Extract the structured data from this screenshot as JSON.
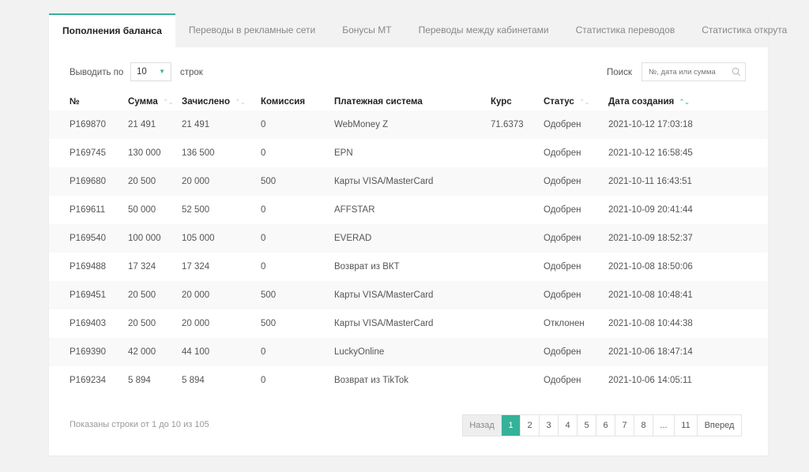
{
  "tabs": [
    {
      "label": "Пополнения баланса",
      "active": true
    },
    {
      "label": "Переводы в рекламные сети"
    },
    {
      "label": "Бонусы МТ"
    },
    {
      "label": "Переводы между кабинетами"
    },
    {
      "label": "Статистика переводов"
    },
    {
      "label": "Статистика открута"
    }
  ],
  "controls": {
    "show_label": "Выводить по",
    "rows_value": "10",
    "rows_suffix": "строк",
    "search_label": "Поиск",
    "search_placeholder": "№, дата или сумма"
  },
  "table": {
    "columns": [
      "№",
      "Сумма",
      "Зачислено",
      "Комиссия",
      "Платежная система",
      "Курс",
      "Статус",
      "Дата создания"
    ],
    "rows": [
      [
        "P169870",
        "21 491",
        "21 491",
        "0",
        "WebMoney Z",
        "71.6373",
        "Одобрен",
        "2021-10-12 17:03:18"
      ],
      [
        "P169745",
        "130 000",
        "136 500",
        "0",
        "EPN",
        "",
        "Одобрен",
        "2021-10-12 16:58:45"
      ],
      [
        "P169680",
        "20 500",
        "20 000",
        "500",
        "Карты VISA/MasterCard",
        "",
        "Одобрен",
        "2021-10-11 16:43:51"
      ],
      [
        "P169611",
        "50 000",
        "52 500",
        "0",
        "AFFSTAR",
        "",
        "Одобрен",
        "2021-10-09 20:41:44"
      ],
      [
        "P169540",
        "100 000",
        "105 000",
        "0",
        "EVERAD",
        "",
        "Одобрен",
        "2021-10-09 18:52:37"
      ],
      [
        "P169488",
        "17 324",
        "17 324",
        "0",
        "Возврат из ВКТ",
        "",
        "Одобрен",
        "2021-10-08 18:50:06"
      ],
      [
        "P169451",
        "20 500",
        "20 000",
        "500",
        "Карты VISA/MasterCard",
        "",
        "Одобрен",
        "2021-10-08 10:48:41"
      ],
      [
        "P169403",
        "20 500",
        "20 000",
        "500",
        "Карты VISA/MasterCard",
        "",
        "Отклонен",
        "2021-10-08 10:44:38"
      ],
      [
        "P169390",
        "42 000",
        "44 100",
        "0",
        "LuckyOnline",
        "",
        "Одобрен",
        "2021-10-06 18:47:14"
      ],
      [
        "P169234",
        "5 894",
        "5 894",
        "0",
        "Возврат из TikTok",
        "",
        "Одобрен",
        "2021-10-06 14:05:11"
      ]
    ]
  },
  "footer": {
    "info": "Показаны строки от 1 до 10 из 105",
    "prev": "Назад",
    "pages": [
      "1",
      "2",
      "3",
      "4",
      "5",
      "6",
      "7",
      "8"
    ],
    "dots": "...",
    "last": "11",
    "next": "Вперед",
    "current_page": "1"
  },
  "colors": {
    "accent": "#35b29a",
    "background": "#f2f2f2",
    "row_alt": "#f9f9f9"
  }
}
